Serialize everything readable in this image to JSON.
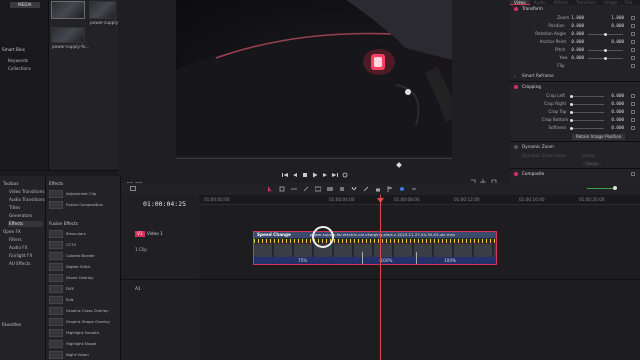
{
  "media_pool": {
    "header": "MEDIA",
    "clips": [
      {
        "label": ""
      },
      {
        "label": "power-supply-f..."
      },
      {
        "label": "power-supply-fo..."
      }
    ],
    "smart_bins_header": "Smart Bins",
    "smart_bins": [
      "Keywords",
      "Collections"
    ]
  },
  "effects_tree": {
    "items": [
      {
        "label": "Toolbox",
        "selected": false
      },
      {
        "label": "Video Transitions",
        "selected": false
      },
      {
        "label": "Audio Transitions",
        "selected": false
      },
      {
        "label": "Titles",
        "selected": false
      },
      {
        "label": "Generators",
        "selected": false
      },
      {
        "label": "Effects",
        "selected": true
      },
      {
        "label": "Open FX",
        "selected": false
      },
      {
        "label": "Filters",
        "selected": false
      },
      {
        "label": "Audio FX",
        "selected": false
      },
      {
        "label": "Fairlight FX",
        "selected": false
      },
      {
        "label": "AU Effects",
        "selected": false
      }
    ],
    "favorites_label": "Favorites"
  },
  "effects_list": {
    "section1": "Effects",
    "effects1": [
      "Adjustment Clip",
      "Fusion Composition"
    ],
    "section2": "Fusion Effects",
    "effects2": [
      "Binoculars",
      "CCTV",
      "Colored Border",
      "Digital Glitch",
      "Drone Overlay",
      "DVE",
      "Edit",
      "Graphic Cross Overlay",
      "Graphic Shape Overlay",
      "Highlight Smooth",
      "Highlight Shape",
      "Night Vision"
    ]
  },
  "viewer": {
    "transport_icons": [
      "skip-start-icon",
      "step-back-icon",
      "stop-icon",
      "play-icon",
      "step-forward-icon",
      "skip-end-icon",
      "loop-icon"
    ]
  },
  "timeline": {
    "timecode": "01:00:04:25",
    "ruler_labels": [
      "01:00:00:00",
      "01:00:04:00",
      "01:00:08:00",
      "01:00:12:00",
      "01:00:16:00",
      "01:00:20:00"
    ],
    "video_track": {
      "id": "V1",
      "name": "Video 1",
      "clips": "1 Clip"
    },
    "audio_track": {
      "id": "A1"
    },
    "clip": {
      "speed_label": "Speed Change",
      "filename": "power-supply-for-electric-car-charging-elect-c-2023-11-27-04-39-43-utc.mov",
      "speeds": [
        "75%",
        "-100%",
        "100%"
      ]
    },
    "accent": "#d9315a",
    "playhead_color": "#e04a4a"
  },
  "inspector": {
    "tabs": [
      "Video",
      "Audio",
      "Effects",
      "Transition",
      "Image",
      "File"
    ],
    "transform": {
      "title": "Transform",
      "rows": [
        {
          "label": "Zoom",
          "x": "1.000",
          "y": "1.000"
        },
        {
          "label": "Position",
          "x": "0.000",
          "y": "0.000"
        },
        {
          "label": "Rotation Angle",
          "x": "0.000"
        },
        {
          "label": "Anchor Point",
          "x": "0.000",
          "y": "0.000"
        },
        {
          "label": "Pitch",
          "x": "0.000"
        },
        {
          "label": "Yaw",
          "x": "0.000"
        },
        {
          "label": "Flip",
          "x": ""
        }
      ]
    },
    "smart_reframe": "Smart Reframe",
    "cropping": {
      "title": "Cropping",
      "rows": [
        {
          "label": "Crop Left",
          "x": "0.000"
        },
        {
          "label": "Crop Right",
          "x": "0.000"
        },
        {
          "label": "Crop Top",
          "x": "0.000"
        },
        {
          "label": "Crop Bottom",
          "x": "0.000"
        },
        {
          "label": "Softness",
          "x": "0.000"
        }
      ],
      "retain": "Retain Image Position"
    },
    "dynamic_zoom": {
      "title": "Dynamic Zoom",
      "ease_label": "Dynamic Zoom Ease",
      "ease_value": "Linear",
      "swap": "Swap"
    },
    "composite": "Composite"
  }
}
